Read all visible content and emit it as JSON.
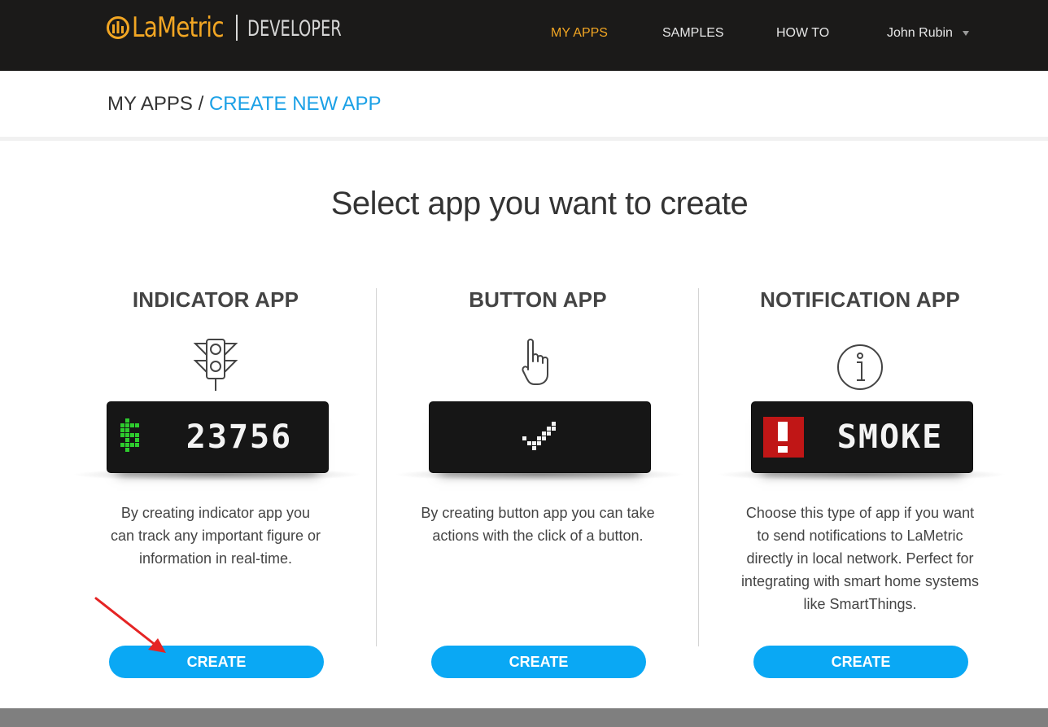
{
  "header": {
    "logo_text": "LaMetric",
    "logo_sub": "DEVELOPER",
    "nav": [
      {
        "label": "MY APPS",
        "active": true
      },
      {
        "label": "SAMPLES",
        "active": false
      },
      {
        "label": "HOW TO",
        "active": false
      }
    ],
    "user": "John Rubin"
  },
  "breadcrumb": {
    "parent": "MY APPS",
    "separator": "/",
    "current": "CREATE NEW APP"
  },
  "page_title": "Select app you want to create",
  "apps": [
    {
      "title": "INDICATOR APP",
      "icon": "traffic-light-icon",
      "display_glyph": "$",
      "display_text": "23756",
      "description_lines": [
        "By creating indicator app you",
        "can track any important figure or",
        "information in real-time."
      ],
      "button": "CREATE"
    },
    {
      "title": "BUTTON APP",
      "icon": "pointing-hand-icon",
      "display_glyph": "check",
      "display_text": "",
      "description_lines": [
        "By creating button app you can take",
        "actions with the click of a button."
      ],
      "button": "CREATE"
    },
    {
      "title": "NOTIFICATION APP",
      "icon": "info-icon",
      "display_glyph": "!",
      "display_text": "SMOKE",
      "description_lines": [
        "Choose this type of app if you want",
        "to send notifications to LaMetric",
        "directly in local network. Perfect for",
        "integrating with smart home systems",
        "like SmartThings."
      ],
      "button": "CREATE"
    }
  ],
  "colors": {
    "header_bg": "#1b1a19",
    "brand_orange": "#f2a623",
    "link_blue": "#1aa0e6",
    "button_blue": "#0aa8f4",
    "annotation_arrow": "#e52424"
  }
}
